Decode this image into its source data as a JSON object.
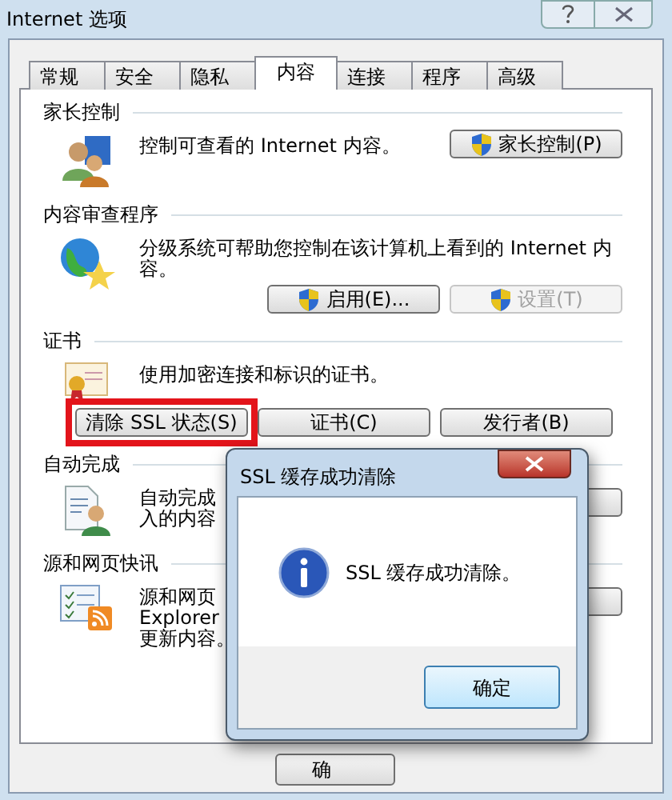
{
  "window": {
    "title": "Internet 选项"
  },
  "tabs": [
    {
      "label": "常规",
      "selected": false
    },
    {
      "label": "安全",
      "selected": false
    },
    {
      "label": "隐私",
      "selected": false
    },
    {
      "label": "内容",
      "selected": true
    },
    {
      "label": "连接",
      "selected": false
    },
    {
      "label": "程序",
      "selected": false
    },
    {
      "label": "高级",
      "selected": false
    }
  ],
  "sections": [
    {
      "kind": "parental",
      "heading": "家长控制",
      "lines": [
        "控制可查看的 Internet 内容。"
      ],
      "buttons": [
        {
          "label": "家长控制(P)",
          "shield": true,
          "disabled": false
        }
      ]
    },
    {
      "kind": "ratings",
      "heading": "内容审查程序",
      "lines": [
        "分级系统可帮助您控制在该计算机上看到的 Internet 内",
        "容。"
      ],
      "buttons": [
        {
          "label": "启用(E)...",
          "shield": true,
          "disabled": false
        },
        {
          "label": "设置(T)",
          "shield": true,
          "disabled": true
        }
      ]
    },
    {
      "kind": "certificates",
      "heading": "证书",
      "lines": [
        "使用加密连接和标识的证书。"
      ],
      "buttons": [
        {
          "label": "清除 SSL 状态(S)",
          "disabled": false,
          "highlighted": true
        },
        {
          "label": "证书(C)",
          "disabled": false
        },
        {
          "label": "发行者(B)",
          "disabled": false
        }
      ]
    },
    {
      "kind": "autocomplete",
      "heading": "自动完成",
      "lines": [
        "自动完成",
        "入的内容"
      ],
      "side_button": true
    },
    {
      "kind": "feeds",
      "heading": "源和网页快讯",
      "lines": [
        "源和网页",
        "Explorer",
        "更新内容。"
      ],
      "side_button": true
    }
  ],
  "footer_buttons": [
    {
      "label": "确"
    }
  ],
  "dialog": {
    "title": "SSL 缓存成功清除",
    "message": "SSL 缓存成功清除。",
    "button": "确定"
  }
}
